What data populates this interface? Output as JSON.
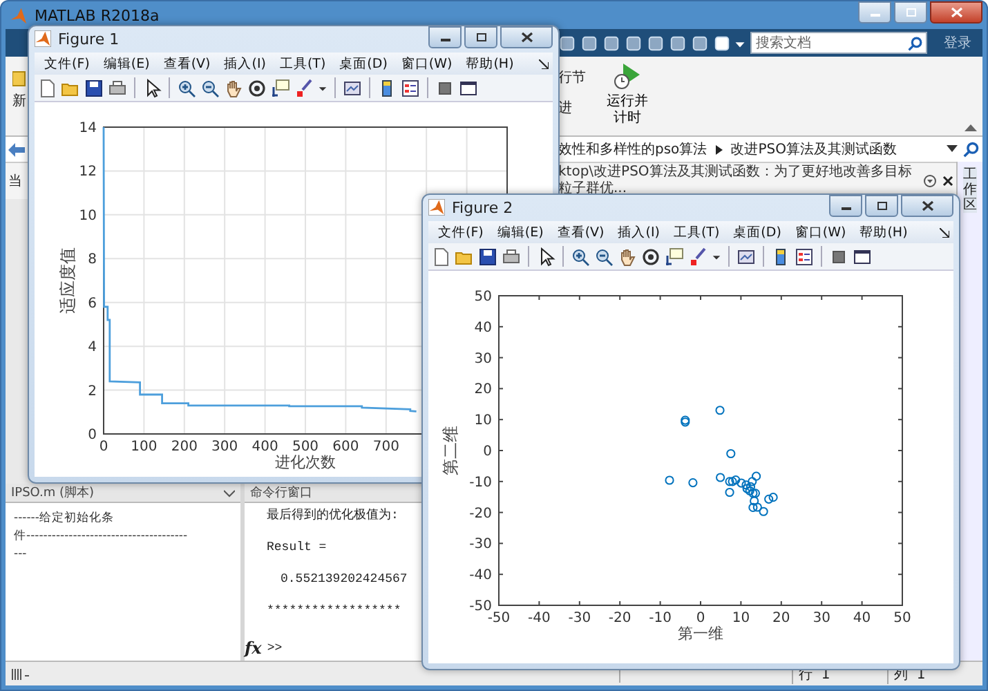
{
  "window": {
    "title": "MATLAB R2018a"
  },
  "toolstrip": {
    "search": {
      "placeholder": "搜索文档"
    },
    "login": "登录"
  },
  "ribbon": {
    "left_fragment": "新",
    "fragments": [
      "行节",
      "进"
    ],
    "run_time_button": "运行并计时"
  },
  "address_bar": {
    "path": [
      "效性和多样性的pso算法",
      "改进PSO算法及其测试函数"
    ]
  },
  "info_bar": {
    "left_fragment": "当",
    "text": "ktop\\改进PSO算法及其测试函数：为了更好地改善多目标粒子群优..."
  },
  "workspace_tab": "工作区",
  "editor": {
    "title": "IPSO.m (脚本)",
    "lines": [
      "------给定初始化条",
      "件--------------------------------------",
      "---"
    ]
  },
  "command_window": {
    "title": "命令行窗口",
    "lines": [
      {
        "kind": "text",
        "text": "最后得到的优化极值为:"
      },
      {
        "kind": "text",
        "text": "Result ="
      },
      {
        "kind": "value",
        "text": "0.552139202424567"
      },
      {
        "kind": "text",
        "text": "******************"
      }
    ],
    "function_icon": "fx",
    "prompt": ">>"
  },
  "status_bar": {
    "row": "行  1",
    "column": "列  1"
  },
  "figures": [
    {
      "title": "Figure 1",
      "menu": [
        "文件(F)",
        "编辑(E)",
        "查看(V)",
        "插入(I)",
        "工具(T)",
        "桌面(D)",
        "窗口(W)",
        "帮助(H)"
      ],
      "chart_data": {
        "type": "line",
        "xlabel": "进化次数",
        "ylabel": "适应度值",
        "xlim": [
          0,
          1000
        ],
        "ylim": [
          0,
          14
        ],
        "grid": true,
        "xticks": [
          0,
          100,
          200,
          300,
          400,
          500,
          600,
          700
        ],
        "yticks": [
          0,
          2,
          4,
          6,
          8,
          10,
          12,
          14
        ],
        "x": [
          0,
          1,
          10,
          10,
          15,
          15,
          90,
          90,
          145,
          145,
          210,
          210,
          460,
          460,
          640,
          640,
          760,
          760,
          775
        ],
        "series": [
          {
            "color": "#4d9fdc",
            "values": [
              14,
              5.8,
              5.8,
              5.2,
              5.2,
              2.4,
              2.35,
              1.8,
              1.8,
              1.4,
              1.4,
              1.3,
              1.3,
              1.27,
              1.27,
              1.2,
              1.12,
              1.05,
              1.03
            ]
          }
        ]
      }
    },
    {
      "title": "Figure 2",
      "menu": [
        "文件(F)",
        "编辑(E)",
        "查看(V)",
        "插入(I)",
        "工具(T)",
        "桌面(D)",
        "窗口(W)",
        "帮助(H)"
      ],
      "chart_data": {
        "type": "scatter",
        "grid": false,
        "xlabel": "第一维",
        "ylabel": "第二维",
        "xlim": [
          -50,
          50
        ],
        "ylim": [
          -50,
          50
        ],
        "xticks": [
          -50,
          -40,
          -30,
          -20,
          -10,
          0,
          10,
          20,
          30,
          40,
          50
        ],
        "yticks": [
          -50,
          -40,
          -30,
          -20,
          -10,
          0,
          10,
          20,
          30,
          40,
          50
        ],
        "x": [
          -3.8,
          -3.8,
          4.8,
          7.5,
          -7.7,
          -1.9,
          4.9,
          7.2,
          7.9,
          8.7,
          7.2,
          10.1,
          11.3,
          11.5,
          12.4,
          12.8,
          13.8,
          12.2,
          13,
          13.6,
          13.3,
          13,
          14.1,
          15.6,
          16.9,
          18
        ],
        "series": [
          {
            "color": "#0072bd",
            "values": [
              9.8,
              9.2,
              13,
              -1,
              -9.6,
              -10.4,
              -8.7,
              -10,
              -10,
              -9.5,
              -13.5,
              -10.5,
              -11.1,
              -12.3,
              -11.7,
              -10,
              -8.3,
              -13,
              -13.8,
              -13.8,
              -16.3,
              -18.4,
              -18.3,
              -19.7,
              -15.7,
              -15.1
            ]
          }
        ]
      }
    }
  ]
}
